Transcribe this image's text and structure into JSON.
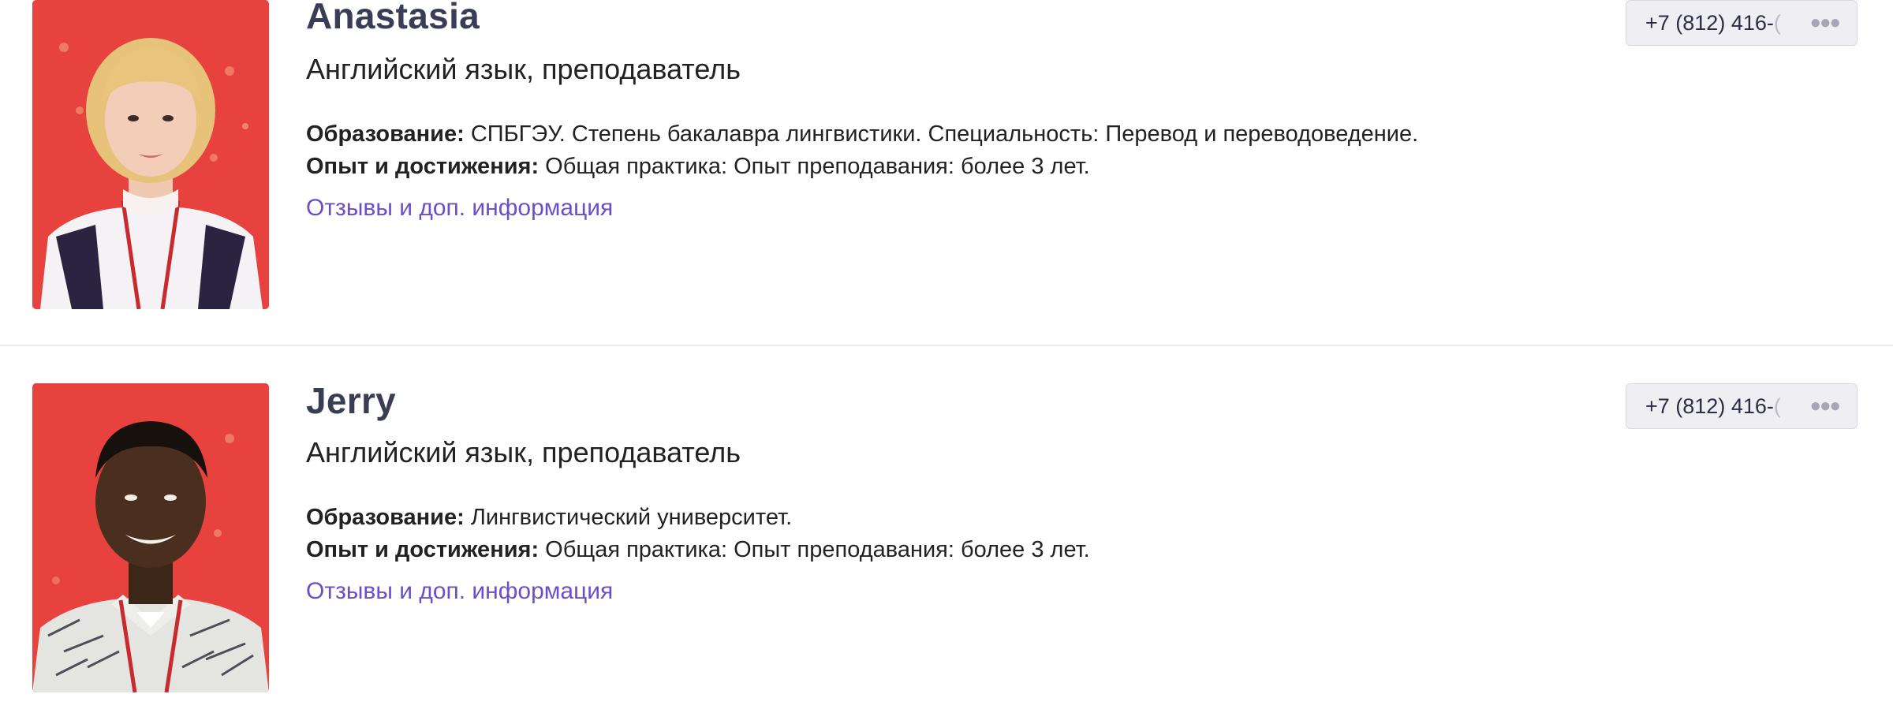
{
  "teachers": [
    {
      "name": "Anastasia",
      "role": "Английский язык, преподаватель",
      "education_label": "Образование:",
      "education": "СПБГЭУ. Степень бакалавра лингвистики. Специальность: Перевод и переводоведение.",
      "experience_label": "Опыт и достижения:",
      "experience": "Общая практика: Опыт преподавания: более 3 лет.",
      "link": "Отзывы и доп. информация",
      "phone_visible": "+7 (812) 416-",
      "phone_faded": "(",
      "phone_more": "●●●"
    },
    {
      "name": "Jerry",
      "role": "Английский язык, преподаватель",
      "education_label": "Образование:",
      "education": "Лингвистический университет.",
      "experience_label": "Опыт и достижения:",
      "experience": "Общая практика: Опыт преподавания: более 3 лет.",
      "link": "Отзывы и доп. информация",
      "phone_visible": "+7 (812) 416-",
      "phone_faded": "(",
      "phone_more": "●●●"
    }
  ],
  "colors": {
    "name": "#3a3d56",
    "link": "#6c4ec8",
    "photo_bg": "#e8423f",
    "phone_bg": "#eeeef3"
  },
  "icons": {
    "more": "more-dots-icon"
  }
}
